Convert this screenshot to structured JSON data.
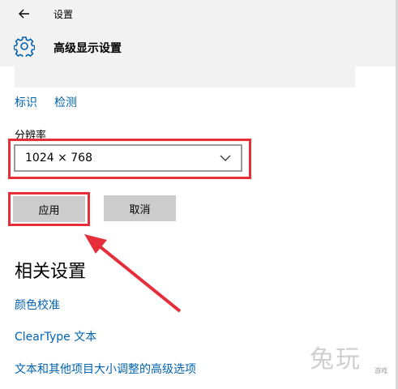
{
  "window": {
    "title": "设置",
    "back_icon": "arrow-left-icon"
  },
  "header": {
    "title": "高级显示设置",
    "icon": "gear-icon"
  },
  "display_links": {
    "identify": "标识",
    "detect": "检测"
  },
  "resolution": {
    "label": "分辨率",
    "value": "1024 × 768"
  },
  "buttons": {
    "apply": "应用",
    "cancel": "取消"
  },
  "related": {
    "title": "相关设置",
    "links": [
      "颜色校准",
      "ClearType 文本",
      "文本和其他项目大小调整的高级选项"
    ]
  },
  "watermark": {
    "text": "兔玩",
    "sub": "游戏"
  },
  "colors": {
    "accent": "#0063b1",
    "highlight": "#e62e3a",
    "button": "#cccccc"
  }
}
